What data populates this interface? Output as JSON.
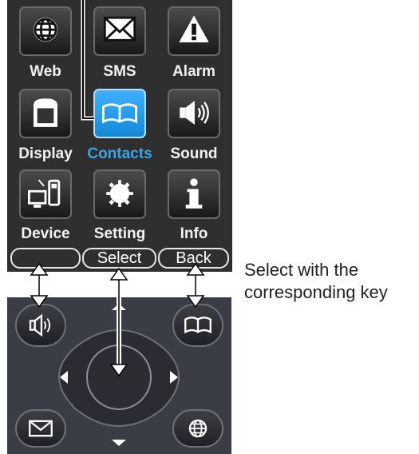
{
  "menu": {
    "items": [
      {
        "label": "Web"
      },
      {
        "label": "SMS"
      },
      {
        "label": "Alarm"
      },
      {
        "label": "Display"
      },
      {
        "label": "Contacts"
      },
      {
        "label": "Sound"
      },
      {
        "label": "Device"
      },
      {
        "label": "Setting"
      },
      {
        "label": "Info"
      }
    ],
    "selected": "Contacts"
  },
  "softkeys": {
    "left": "",
    "center": "Select",
    "right": "Back"
  },
  "callout": {
    "line1": "Select with the",
    "line2": "corresponding key"
  },
  "colors": {
    "screen_bg": "#2f2f2f",
    "selected_accent": "#3aa6ea",
    "keypad_bg": "#3a3d45"
  }
}
